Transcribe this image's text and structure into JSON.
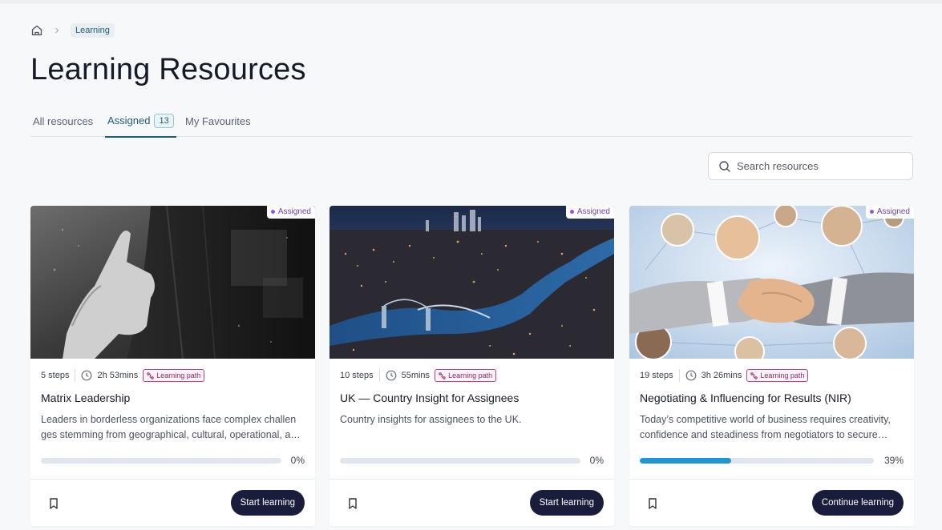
{
  "breadcrumb": {
    "current": "Learning"
  },
  "page": {
    "title": "Learning Resources"
  },
  "tabs": [
    {
      "label": "All resources"
    },
    {
      "label": "Assigned",
      "count": "13"
    },
    {
      "label": "My Favourites"
    }
  ],
  "search": {
    "placeholder": "Search resources"
  },
  "cards": [
    {
      "badge": "Assigned",
      "steps": "5 steps",
      "duration": "2h 53mins",
      "type": "Learning path",
      "title": "Matrix Leadership",
      "description": "Leaders in borderless organizations face complex challen ges stemming from geographical, cultural, operational, and organizational differences.",
      "progress": 0,
      "progress_label": "0%",
      "cta": "Start learning"
    },
    {
      "badge": "Assigned",
      "steps": "10 steps",
      "duration": "55mins",
      "type": "Learning path",
      "title": "UK — Country Insight for Assignees",
      "description": "Country insights for assignees to the UK.",
      "progress": 0,
      "progress_label": "0%",
      "cta": "Start learning"
    },
    {
      "badge": "Assigned",
      "steps": "19 steps",
      "duration": "3h 26mins",
      "type": "Learning path",
      "title": "Negotiating & Influencing for Results (NIR)",
      "description": "Today’s competitive world of business requires creativity, confidence and steadiness from negotiators to secure deals.",
      "progress": 39,
      "progress_label": "39%",
      "cta": "Continue learning"
    }
  ],
  "colors": {
    "accent": "#1c5d73",
    "button": "#191c3a",
    "progress": "#2095d6",
    "badge_purple": "#8a5cd6",
    "path_badge": "#b0468c"
  }
}
